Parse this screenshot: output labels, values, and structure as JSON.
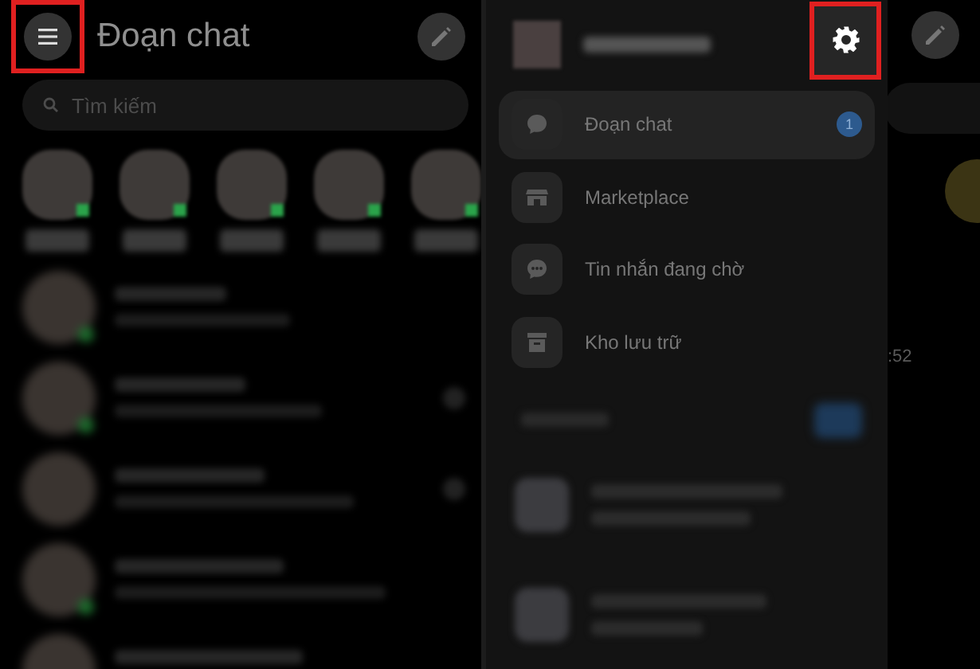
{
  "chat_screen": {
    "title": "Đoạn chat",
    "menu_button": {
      "highlighted": true
    },
    "search": {
      "placeholder": "Tìm kiếm"
    },
    "stories": [
      {
        "online": true
      },
      {
        "online": true
      },
      {
        "online": true
      },
      {
        "online": true
      },
      {
        "online": true
      }
    ],
    "chats": [
      {
        "online": true,
        "seen": false
      },
      {
        "online": true,
        "seen": true
      },
      {
        "online": false,
        "seen": true
      },
      {
        "online": true,
        "seen": false
      },
      {
        "online": false,
        "seen": false
      }
    ]
  },
  "drawer_screen": {
    "settings_button": {
      "highlighted": true
    },
    "menu_items": [
      {
        "label": "Đoạn chat",
        "kind": "chat",
        "selected": true,
        "badge": "1"
      },
      {
        "label": "Marketplace",
        "kind": "store",
        "selected": false
      },
      {
        "label": "Tin nhắn đang chờ",
        "kind": "pending",
        "selected": false
      },
      {
        "label": "Kho lưu trữ",
        "kind": "archive",
        "selected": false
      }
    ],
    "background_time": ":52"
  }
}
